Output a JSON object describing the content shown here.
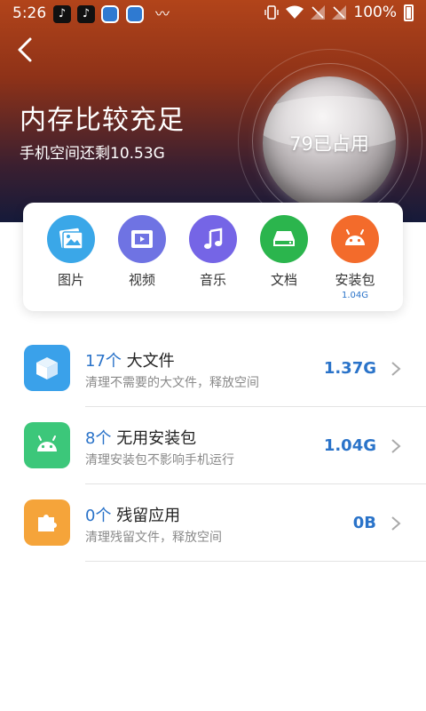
{
  "status": {
    "time": "5:26",
    "battery": "100%"
  },
  "hero": {
    "title": "内存比较充足",
    "subtitle": "手机空间还剩10.53G",
    "orb_text": "79已占用"
  },
  "categories": [
    {
      "label": "图片",
      "icon": "image-icon",
      "color": "#3aa7e8"
    },
    {
      "label": "视频",
      "icon": "film-icon",
      "color": "#6f73e3"
    },
    {
      "label": "音乐",
      "icon": "music-note-icon",
      "color": "#7565e6"
    },
    {
      "label": "文档",
      "icon": "document-drive-icon",
      "color": "#2bb54d"
    },
    {
      "label": "安装包",
      "icon": "android-icon",
      "color": "#f36b2b",
      "size": "1.04G"
    }
  ],
  "rows": [
    {
      "count": "17个",
      "title": "大文件",
      "desc": "清理不需要的大文件，释放空间",
      "size": "1.37G",
      "icon": "cube-icon",
      "color": "#3aa1ea"
    },
    {
      "count": "8个",
      "title": "无用安装包",
      "desc": "清理安装包不影响手机运行",
      "size": "1.04G",
      "icon": "android-icon",
      "color": "#3cc77a"
    },
    {
      "count": "0个",
      "title": "残留应用",
      "desc": "清理残留文件，释放空间",
      "size": "0B",
      "icon": "puzzle-icon",
      "color": "#f5a43a"
    }
  ]
}
